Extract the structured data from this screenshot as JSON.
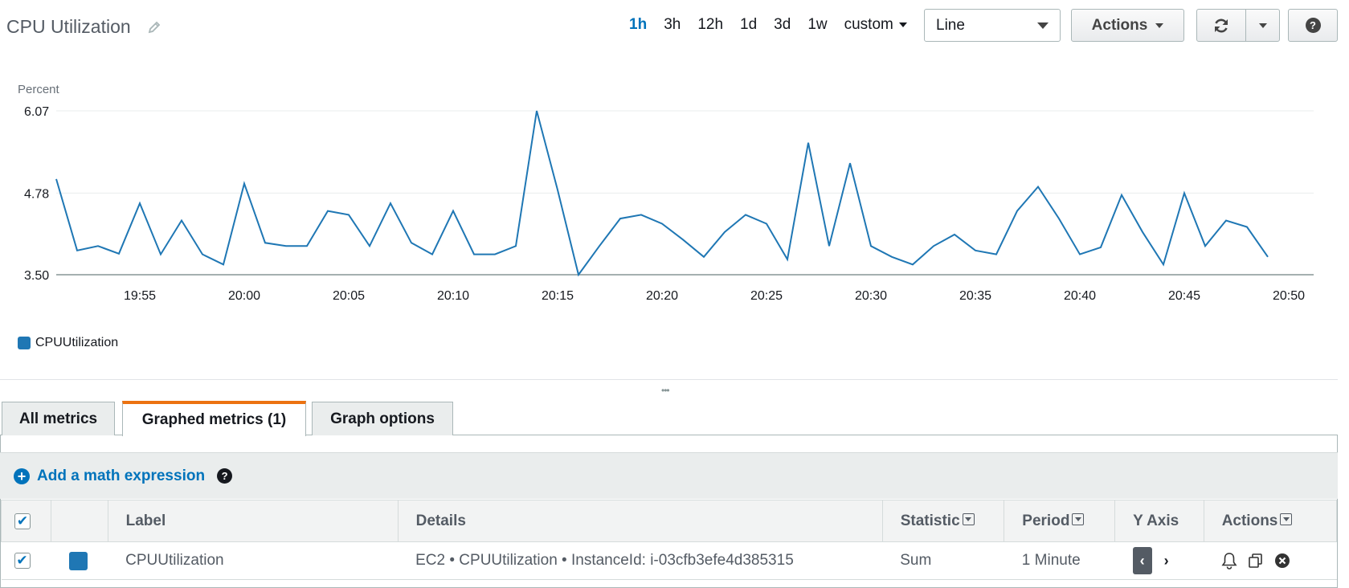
{
  "header": {
    "title": "CPU Utilization",
    "ranges": [
      "1h",
      "3h",
      "12h",
      "1d",
      "3d",
      "1w"
    ],
    "active_range": "1h",
    "custom_label": "custom",
    "graph_type": "Line",
    "actions_label": "Actions",
    "help_label": "?"
  },
  "chart_data": {
    "type": "line",
    "ylabel": "Percent",
    "y_ticks": [
      "3.50",
      "4.78",
      "6.07"
    ],
    "ylim": [
      3.5,
      6.07
    ],
    "x_tick_labels": [
      "19:55",
      "20:00",
      "20:05",
      "20:10",
      "20:15",
      "20:20",
      "20:25",
      "20:30",
      "20:35",
      "20:40",
      "20:45",
      "20:50"
    ],
    "x_start": "19:51",
    "series": [
      {
        "name": "CPUUtilization",
        "color": "#1f77b4",
        "values": [
          5.0,
          3.88,
          3.95,
          3.83,
          4.62,
          3.82,
          4.35,
          3.82,
          3.66,
          4.93,
          4.0,
          3.95,
          3.95,
          4.5,
          4.44,
          3.95,
          4.62,
          4.0,
          3.82,
          4.5,
          3.82,
          3.82,
          3.95,
          6.07,
          4.83,
          3.5,
          3.95,
          4.38,
          4.44,
          4.3,
          4.05,
          3.78,
          4.17,
          4.44,
          4.3,
          3.74,
          5.57,
          3.95,
          5.25,
          3.95,
          3.78,
          3.66,
          3.95,
          4.13,
          3.88,
          3.82,
          4.5,
          4.88,
          4.38,
          3.82,
          3.93,
          4.75,
          4.17,
          3.66,
          4.78,
          3.95,
          4.35,
          4.25,
          3.78
        ]
      }
    ],
    "grid": true,
    "legend_position": "bottom-left"
  },
  "tabs": [
    {
      "label": "All metrics"
    },
    {
      "label": "Graphed metrics (1)"
    },
    {
      "label": "Graph options"
    }
  ],
  "math": {
    "label": "Add a math expression"
  },
  "table": {
    "headers": {
      "label": "Label",
      "details": "Details",
      "statistic": "Statistic",
      "period": "Period",
      "yaxis": "Y Axis",
      "actions": "Actions"
    },
    "rows": [
      {
        "color": "#1f77b4",
        "label": "CPUUtilization",
        "details": "EC2 • CPUUtilization • InstanceId: i-03cfb3efe4d385315",
        "statistic": "Sum",
        "period": "1 Minute"
      }
    ]
  }
}
